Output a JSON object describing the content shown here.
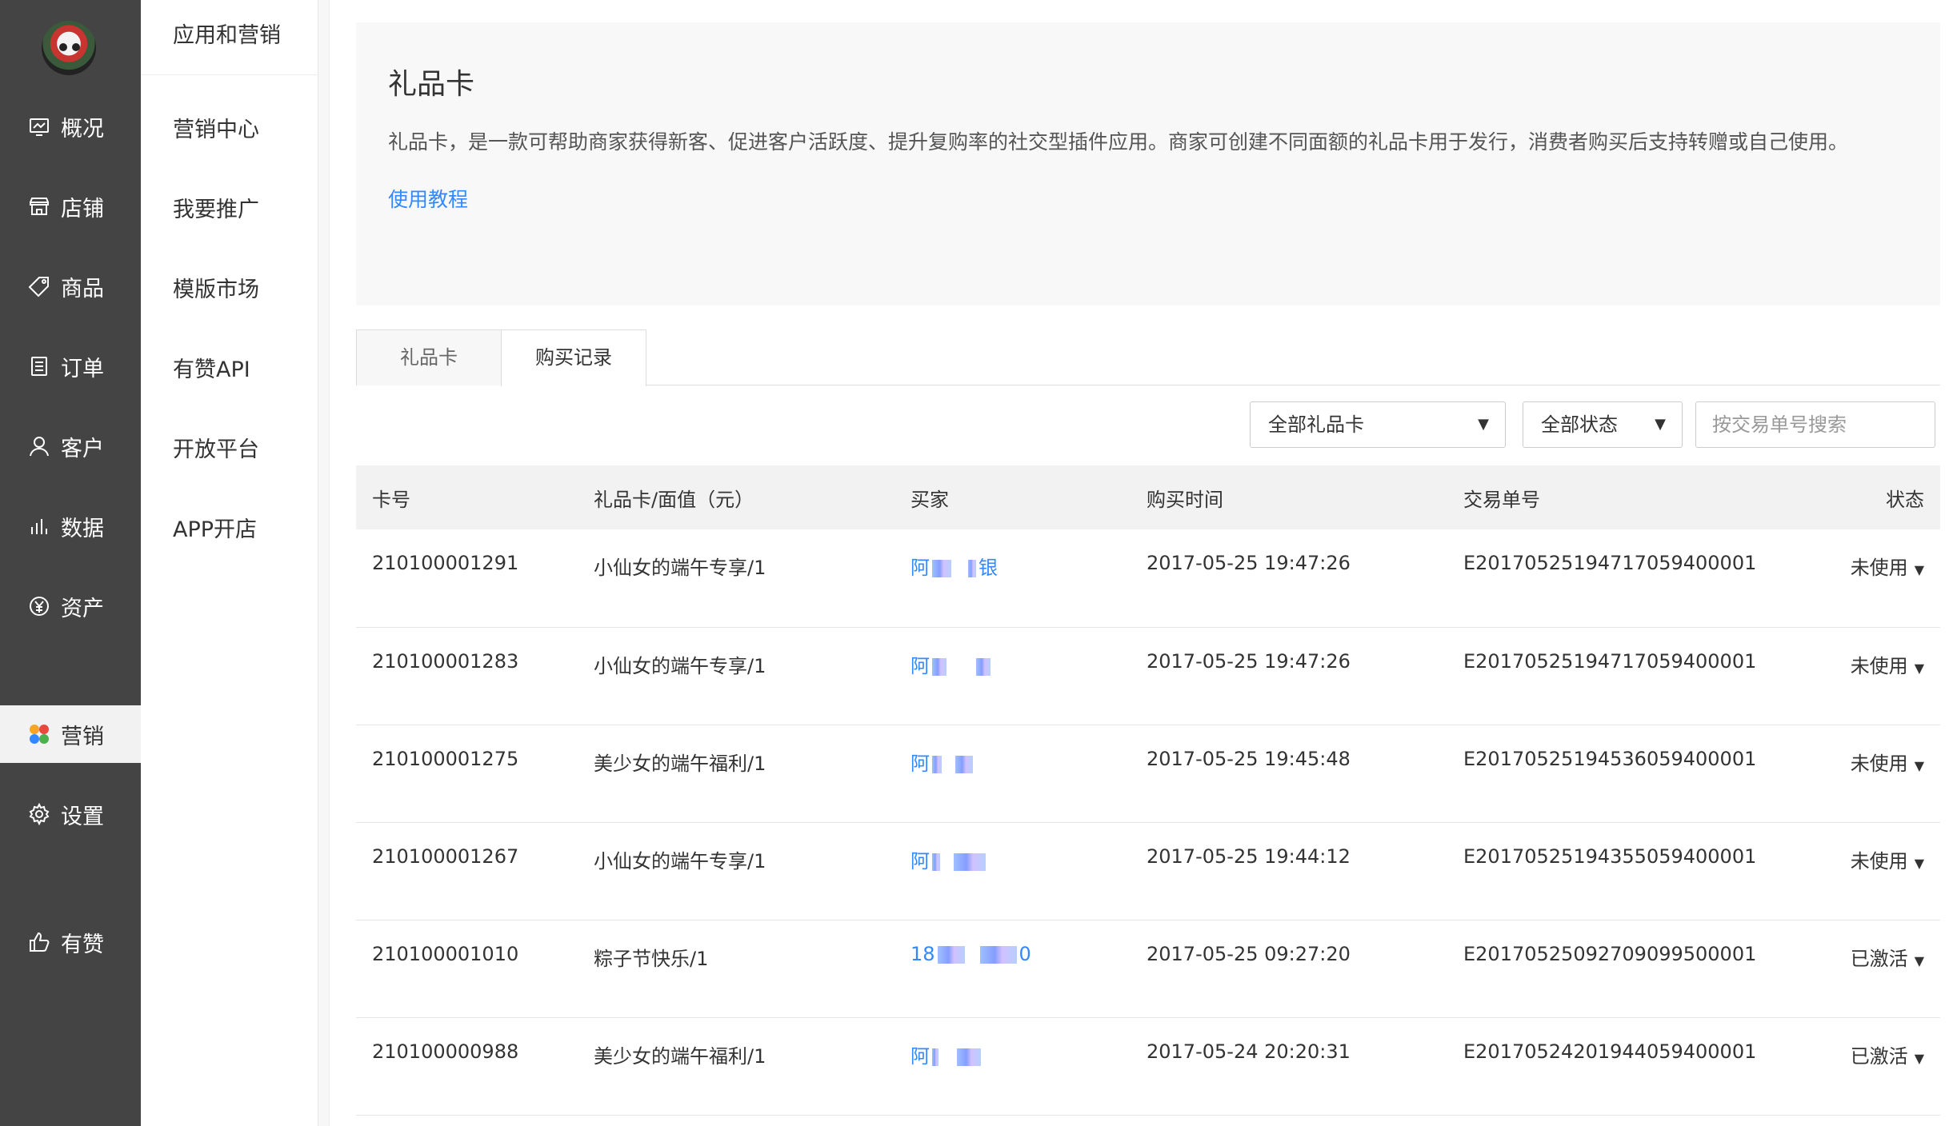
{
  "nav": {
    "items": [
      {
        "label": "概况",
        "icon": "dashboard-icon"
      },
      {
        "label": "店铺",
        "icon": "store-icon"
      },
      {
        "label": "商品",
        "icon": "tag-icon"
      },
      {
        "label": "订单",
        "icon": "order-list-icon"
      },
      {
        "label": "客户",
        "icon": "user-icon"
      },
      {
        "label": "数据",
        "icon": "bar-chart-icon"
      },
      {
        "label": "资产",
        "icon": "yen-icon"
      },
      {
        "label": "营销",
        "icon": "marketing-icon"
      },
      {
        "label": "设置",
        "icon": "gear-icon"
      },
      {
        "label": "有赞",
        "icon": "thumbs-up-icon"
      }
    ],
    "active": "营销"
  },
  "subnav": {
    "title": "应用和营销",
    "items": [
      "营销中心",
      "我要推广",
      "模版市场",
      "有赞API",
      "开放平台",
      "APP开店"
    ]
  },
  "intro": {
    "title": "礼品卡",
    "description": "礼品卡，是一款可帮助商家获得新客、促进客户活跃度、提升复购率的社交型插件应用。商家可创建不同面额的礼品卡用于发行，消费者购买后支持转赠或自己使用。",
    "tutorial_link": "使用教程"
  },
  "tabs": [
    {
      "label": "礼品卡",
      "active": false
    },
    {
      "label": "购买记录",
      "active": true
    }
  ],
  "filters": {
    "card_select": "全部礼品卡",
    "status_select": "全部状态",
    "search_placeholder": "按交易单号搜索"
  },
  "table": {
    "headers": [
      "卡号",
      "礼品卡/面值（元）",
      "买家",
      "购买时间",
      "交易单号",
      "状态"
    ],
    "rows": [
      {
        "card_no": "210100001291",
        "card": "小仙女的端午专享/1",
        "buyer_prefix": "阿",
        "buyer_suffix": "银",
        "time": "2017-05-25 19:47:26",
        "trade_no": "E20170525194717059400001",
        "status": "未使用"
      },
      {
        "card_no": "210100001283",
        "card": "小仙女的端午专享/1",
        "buyer_prefix": "阿",
        "buyer_suffix": "",
        "time": "2017-05-25 19:47:26",
        "trade_no": "E20170525194717059400001",
        "status": "未使用"
      },
      {
        "card_no": "210100001275",
        "card": "美少女的端午福利/1",
        "buyer_prefix": "阿",
        "buyer_suffix": "",
        "time": "2017-05-25 19:45:48",
        "trade_no": "E20170525194536059400001",
        "status": "未使用"
      },
      {
        "card_no": "210100001267",
        "card": "小仙女的端午专享/1",
        "buyer_prefix": "阿",
        "buyer_suffix": "",
        "time": "2017-05-25 19:44:12",
        "trade_no": "E20170525194355059400001",
        "status": "未使用"
      },
      {
        "card_no": "210100001010",
        "card": "粽子节快乐/1",
        "buyer_prefix": "18",
        "buyer_suffix": "0",
        "time": "2017-05-25 09:27:20",
        "trade_no": "E20170525092709099500001",
        "status": "已激活"
      },
      {
        "card_no": "210100000988",
        "card": "美少女的端午福利/1",
        "buyer_prefix": "阿",
        "buyer_suffix": "",
        "time": "2017-05-24 20:20:31",
        "trade_no": "E20170524201944059400001",
        "status": "已激活"
      }
    ]
  }
}
